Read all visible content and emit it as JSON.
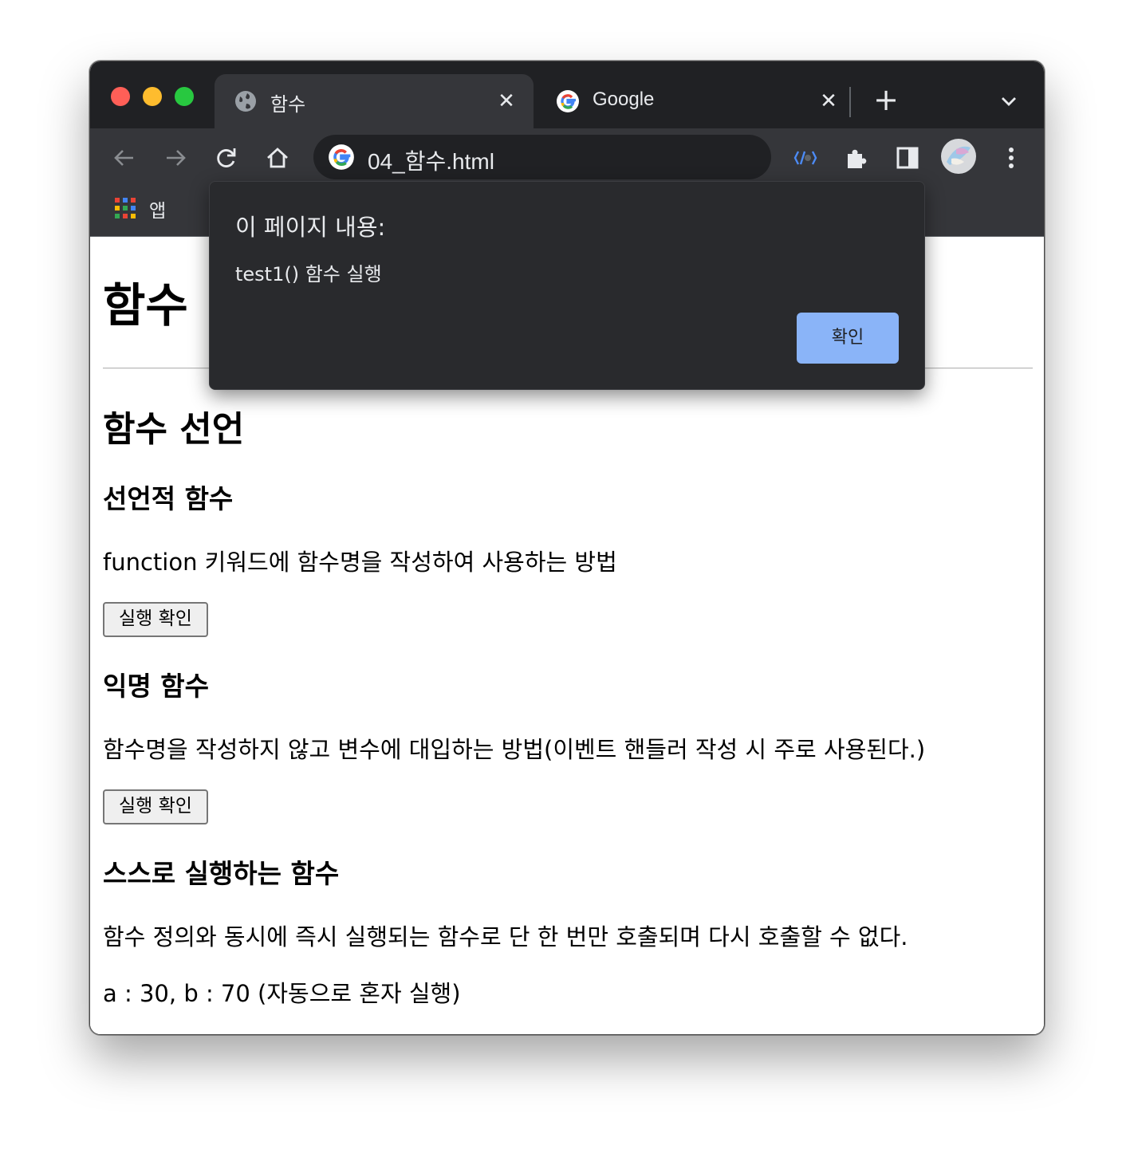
{
  "browser": {
    "tabs": [
      {
        "title": "함수",
        "active": true,
        "favicon": "globe-icon"
      },
      {
        "title": "Google",
        "active": false,
        "favicon": "google-icon"
      }
    ],
    "omnibox": {
      "url": "04_함수.html"
    },
    "bookmarks": {
      "apps_label": "앱"
    }
  },
  "dialog": {
    "title": "이 페이지 내용:",
    "message": "test1() 함수 실행",
    "ok_label": "확인"
  },
  "page": {
    "h1": "함수",
    "h2": "함수 선언",
    "sections": [
      {
        "heading": "선언적 함수",
        "text": "function 키워드에 함수명을 작성하여 사용하는 방법",
        "button": "실행 확인"
      },
      {
        "heading": "익명 함수",
        "text": "함수명을 작성하지 않고 변수에 대입하는 방법(이벤트 핸들러 작성 시 주로 사용된다.)",
        "button": "실행 확인"
      },
      {
        "heading": "스스로 실행하는 함수",
        "text": "함수 정의와 동시에 즉시 실행되는 함수로 단 한 번만 호출되며 다시 호출할 수 없다.",
        "result": "a : 30, b : 70 (자동으로 혼자 실행)"
      }
    ]
  },
  "colors": {
    "tabstrip": "#202124",
    "toolbar": "#35363a",
    "dialog_bg": "#292a2d",
    "dialog_button": "#8ab4f8"
  }
}
